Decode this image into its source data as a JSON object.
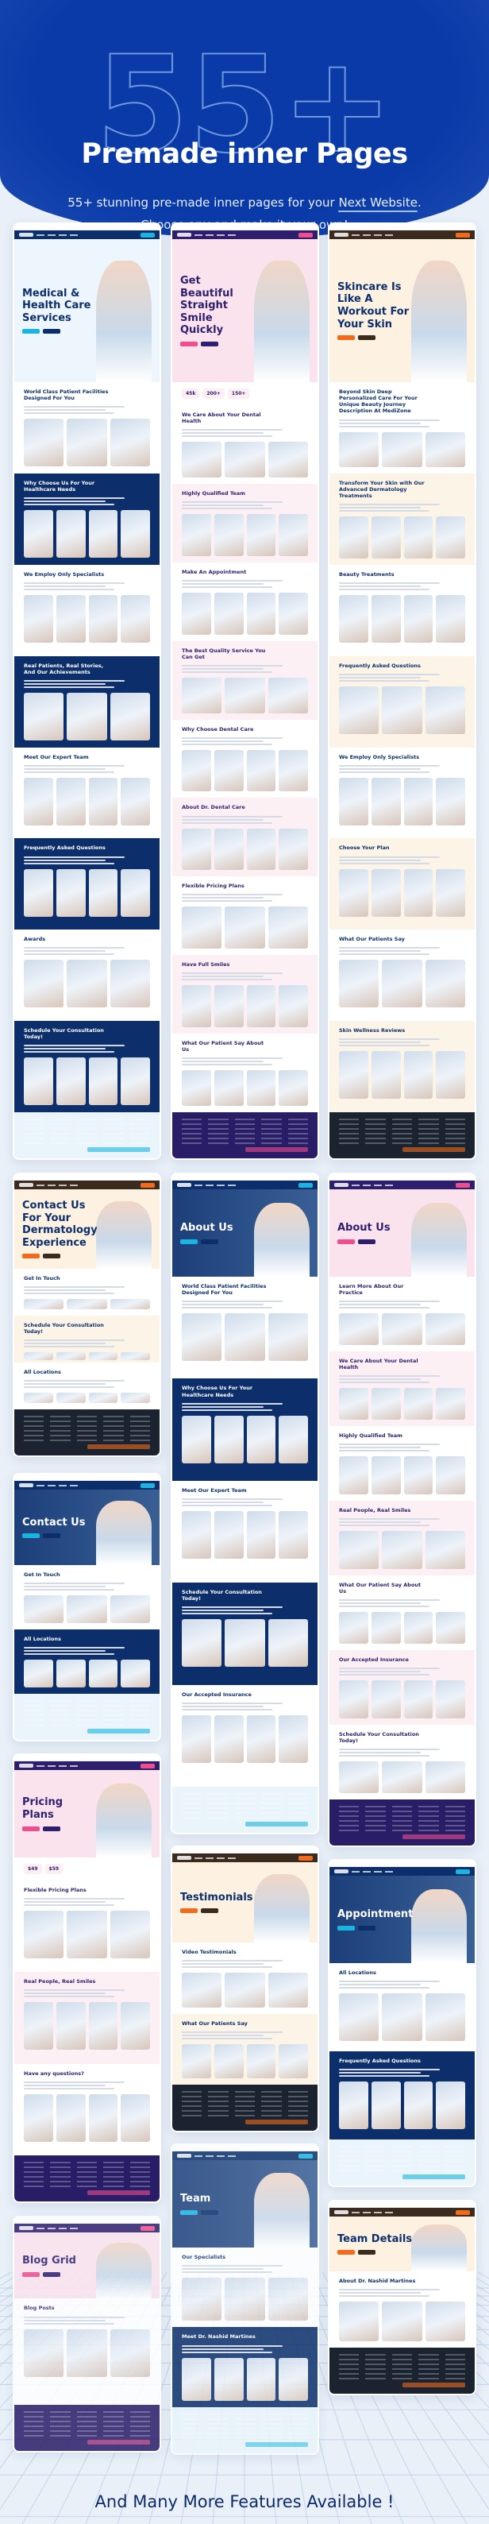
{
  "header": {
    "big_number": "55+",
    "title": "Premade inner Pages",
    "subtitle_before": "55+ stunning pre-made inner pages for your ",
    "subtitle_highlight": "Next Website",
    "subtitle_after": ".",
    "subtitle_line2": "Choose any and make it your own!",
    "colors": {
      "background": "#0a3aa8",
      "outline": "#8fb8f0"
    }
  },
  "themes": {
    "medical": {
      "nav": "#0c2f6b",
      "accent": "#19b4e0",
      "hero_bg": "#eef6fd",
      "title": "#0c2f6b",
      "alt_bg": "#0c2f6b",
      "foot": "#eaf4fb",
      "foot_text": "#0c2f6b"
    },
    "dental": {
      "nav": "#2e1f6e",
      "accent": "#ee4d8e",
      "hero_bg": "#fbe3ee",
      "title": "#2e1f6e",
      "alt_bg": "#fdf0f5",
      "foot": "#2a1d68",
      "foot_text": "#ffffff"
    },
    "skin": {
      "nav": "#3b2a1e",
      "accent": "#f26b1d",
      "hero_bg": "#fdf1e2",
      "title": "#0c2f6b",
      "alt_bg": "#fdf4e8",
      "foot": "#1b2330",
      "foot_text": "#ffffff"
    }
  },
  "columns": [
    [
      {
        "theme": "medical",
        "title": "Medical & Health Care Services",
        "sections": [
          "World Class Patient Facilities Designed For You",
          "Why Choose Us For Your Healthcare Needs",
          "We Employ Only Specialists",
          "Real Patients, Real Stories, And Our Achievements",
          "Meet Our Expert Team",
          "Frequently Asked Questions",
          "Awards",
          "Schedule Your Consultation Today!"
        ]
      },
      {
        "theme": "skin",
        "title": "Contact Us For Your Dermatology Experience",
        "sections": [
          "Get In Touch",
          "Schedule Your Consultation Today!",
          "All Locations"
        ]
      },
      {
        "theme": "medical",
        "title": "Contact Us",
        "sections": [
          "Get In Touch",
          "All Locations"
        ]
      },
      {
        "theme": "dental",
        "title": "Pricing Plans",
        "sections": [
          "Flexible Pricing Plans",
          "Real People, Real Smiles",
          "Have any questions?"
        ],
        "stats": [
          "$49",
          "$59"
        ]
      },
      {
        "theme": "dental",
        "title": "Blog Grid",
        "sections": [
          "Blog Posts"
        ]
      }
    ],
    [
      {
        "theme": "dental",
        "title": "Get Beautiful Straight Smile Quickly",
        "sections": [
          "We Care About Your Dental Health",
          "Highly Qualified Team",
          "Make An Appointment",
          "The Best Quality Service You Can Get",
          "Why Choose Dental Care",
          "About Dr. Dental Care",
          "Flexible Pricing Plans",
          "Have Full Smiles",
          "What Our Patient Say About Us"
        ],
        "stats": [
          "45k",
          "200+",
          "150+"
        ]
      },
      {
        "theme": "medical",
        "title": "About Us",
        "sections": [
          "World Class Patient Facilities Designed For You",
          "Why Choose Us For Your Healthcare Needs",
          "Meet Our Expert Team",
          "Schedule Your Consultation Today!",
          "Our Accepted Insurance"
        ]
      },
      {
        "theme": "skin",
        "title": "Testimonials",
        "sections": [
          "Video Testimonials",
          "What Our Patients Say"
        ]
      },
      {
        "theme": "medical",
        "title": "Team",
        "sections": [
          "Our Specialists",
          "Meet Dr. Nashid Martines"
        ]
      }
    ],
    [
      {
        "theme": "skin",
        "title": "Skincare Is Like A Workout For Your Skin",
        "sections": [
          "Beyond Skin Deep Personalized Care For Your Unique Beauty Journey Description At MediZone",
          "Transform Your Skin with Our Advanced Dermatology Treatments",
          "Beauty Treatments",
          "Frequently Asked Questions",
          "We Employ Only Specialists",
          "Choose Your Plan",
          "What Our Patients Say",
          "Skin Wellness Reviews"
        ]
      },
      {
        "theme": "dental",
        "title": "About Us",
        "sections": [
          "Learn More About Our Practice",
          "We Care About Your Dental Health",
          "Highly Qualified Team",
          "Real People, Real Smiles",
          "What Our Patient Say About Us",
          "Our Accepted Insurance",
          "Schedule Your Consultation Today!"
        ]
      },
      {
        "theme": "medical",
        "title": "Appointment",
        "sections": [
          "All Locations",
          "Frequently Asked Questions"
        ]
      },
      {
        "theme": "skin",
        "title": "Team Details",
        "sections": [
          "About Dr. Nashid Martines"
        ]
      }
    ]
  ],
  "footer_text": "And Many More Features Available !"
}
